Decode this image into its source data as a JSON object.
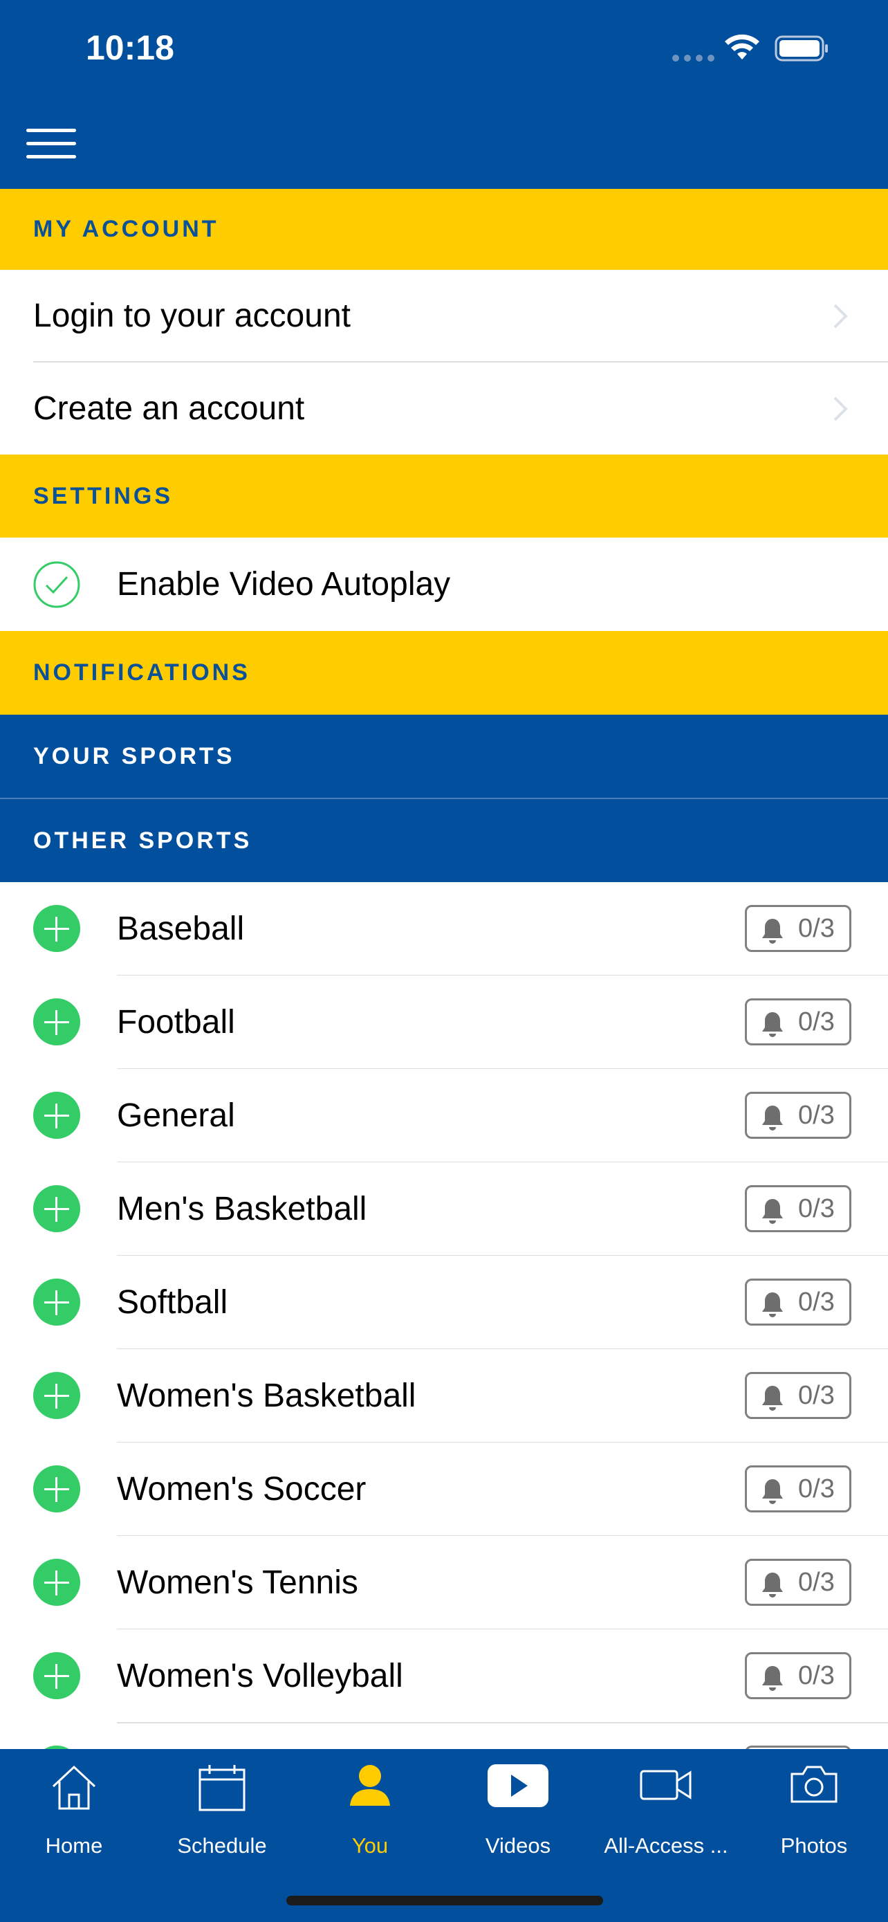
{
  "status_bar": {
    "time": "10:18"
  },
  "sections": {
    "my_account": "MY ACCOUNT",
    "settings": "SETTINGS",
    "notifications": "NOTIFICATIONS",
    "your_sports": "YOUR SPORTS",
    "other_sports": "OTHER SPORTS"
  },
  "account": {
    "login": "Login to your account",
    "create": "Create an account"
  },
  "settings": {
    "autoplay": "Enable Video Autoplay",
    "autoplay_enabled": true
  },
  "sports": [
    {
      "name": "Baseball",
      "count": "0/3"
    },
    {
      "name": "Football",
      "count": "0/3"
    },
    {
      "name": "General",
      "count": "0/3"
    },
    {
      "name": "Men's Basketball",
      "count": "0/3"
    },
    {
      "name": "Softball",
      "count": "0/3"
    },
    {
      "name": "Women's Basketball",
      "count": "0/3"
    },
    {
      "name": "Women's Soccer",
      "count": "0/3"
    },
    {
      "name": "Women's Tennis",
      "count": "0/3"
    },
    {
      "name": "Women's Volleyball",
      "count": "0/3"
    }
  ],
  "tabs": [
    {
      "label": "Home",
      "icon": "home-icon",
      "active": false
    },
    {
      "label": "Schedule",
      "icon": "calendar-icon",
      "active": false
    },
    {
      "label": "You",
      "icon": "person-icon",
      "active": true
    },
    {
      "label": "Videos",
      "icon": "play-icon",
      "active": false
    },
    {
      "label": "All-Access ...",
      "icon": "video-camera-icon",
      "active": false
    },
    {
      "label": "Photos",
      "icon": "camera-icon",
      "active": false
    }
  ],
  "colors": {
    "brand_blue": "#02509d",
    "brand_yellow": "#ffcc00",
    "accent_green": "#33cc66",
    "active_tab": "#ffcc00"
  }
}
